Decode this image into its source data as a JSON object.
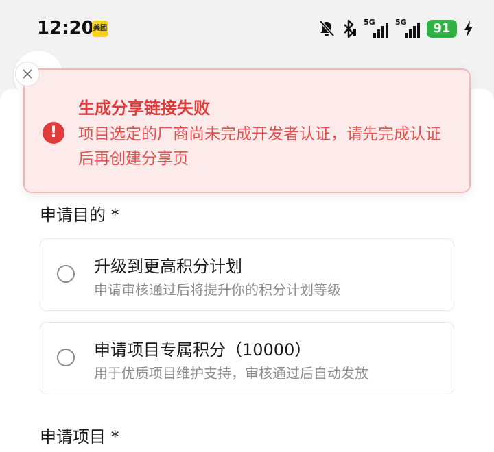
{
  "status_bar": {
    "time": "12:20",
    "app_badge": "美团",
    "signal1_label": "5G",
    "signal2_label": "5G",
    "battery_level": "91"
  },
  "toast": {
    "title": "生成分享链接失败",
    "message": "项目选定的厂商尚未完成开发者认证，请先完成认证后再创建分享页"
  },
  "form": {
    "purpose_label": "申请目的 *",
    "options": [
      {
        "title": "升级到更高积分计划",
        "desc": "申请审核通过后将提升你的积分计划等级"
      },
      {
        "title": "申请项目专属积分（10000）",
        "desc": "用于优质项目维护支持，审核通过后自动发放"
      }
    ],
    "project_label": "申请项目 *"
  },
  "colors": {
    "toast_bg": "#fdeaea",
    "toast_border": "#f4b7b7",
    "error_red": "#de3b3b",
    "battery_green": "#2fb344"
  }
}
